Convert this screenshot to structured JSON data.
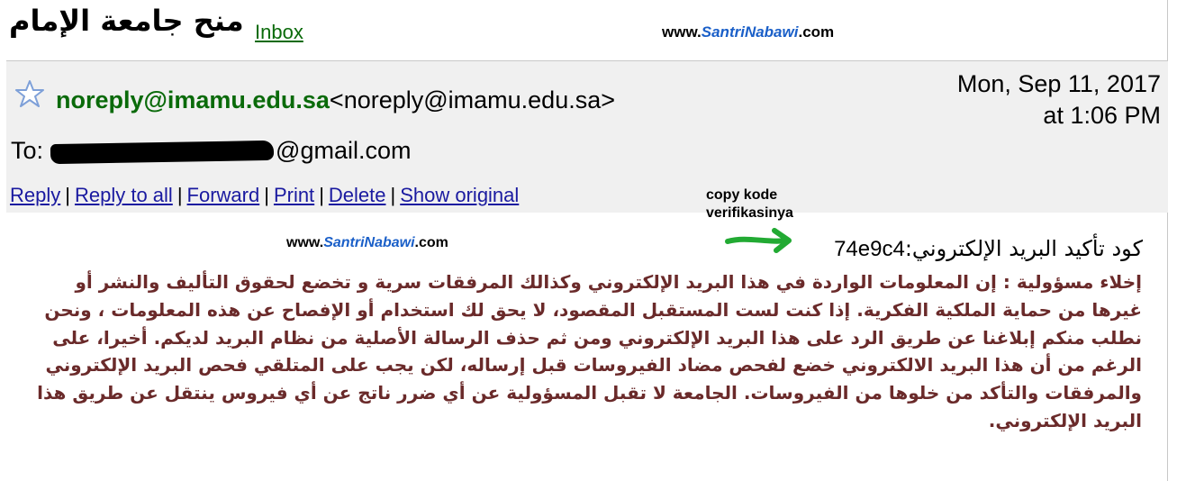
{
  "topbar": {
    "subject": "منح جامعة الإمام",
    "inbox_label": "Inbox",
    "watermark": {
      "prefix": "www.",
      "middle": "SantriNabawi",
      "suffix": ".com"
    }
  },
  "header": {
    "sender_name": "noreply@imamu.edu.sa",
    "sender_address": "<noreply@imamu.edu.sa>",
    "date": "Mon, Sep 11, 2017",
    "time": "at 1:06 PM",
    "to_label": "To:",
    "to_suffix": "@gmail.com",
    "actions": [
      {
        "label": "Reply"
      },
      {
        "label": "Reply to all"
      },
      {
        "label": "Forward"
      },
      {
        "label": "Print"
      },
      {
        "label": "Delete"
      },
      {
        "label": "Show original"
      }
    ]
  },
  "annotation": {
    "line1": "copy kode",
    "line2": "verifikasinya"
  },
  "body": {
    "watermark": {
      "prefix": "www.",
      "middle": "SantriNabawi",
      "suffix": ".com"
    },
    "verify_label": "كود تأكيد البريد الإلكتروني:",
    "verify_code": "74e9c4",
    "disclaimer": "إخلاء مسؤولية : إن المعلومات الواردة في هذا البريد الإلكتروني وكذالك المرفقات سرية و تخضع لحقوق التأليف والنشر أو غيرها من حماية الملكية الفكرية. إذا كنت لست المستقبل المقصود، لا يحق لك استخدام أو الإفصاح عن هذه المعلومات ، ونحن نطلب منكم إبلاغنا عن طريق الرد على هذا البريد الإلكتروني ومن ثم حذف الرسالة الأصلية من نظام البريد لديكم. أخيرا، على الرغم من أن هذا البريد الالكتروني خضع لفحص مضاد الفيروسات قبل إرساله، لكن يجب على المتلقي فحص البريد الإلكتروني والمرفقات والتأكد من خلوها من الفيروسات. الجامعة لا تقبل المسؤولية عن أي ضرر ناتج عن أي فيروس ينتقل عن طريق هذا البريد الإلكتروني."
  },
  "colors": {
    "sender": "#0a6a0a",
    "link": "#1a1aa0",
    "disclaimer": "#6a2a2a",
    "header_bg": "#f0f0f0",
    "watermark_accent": "#1a5fc8",
    "arrow": "#22aa33"
  }
}
